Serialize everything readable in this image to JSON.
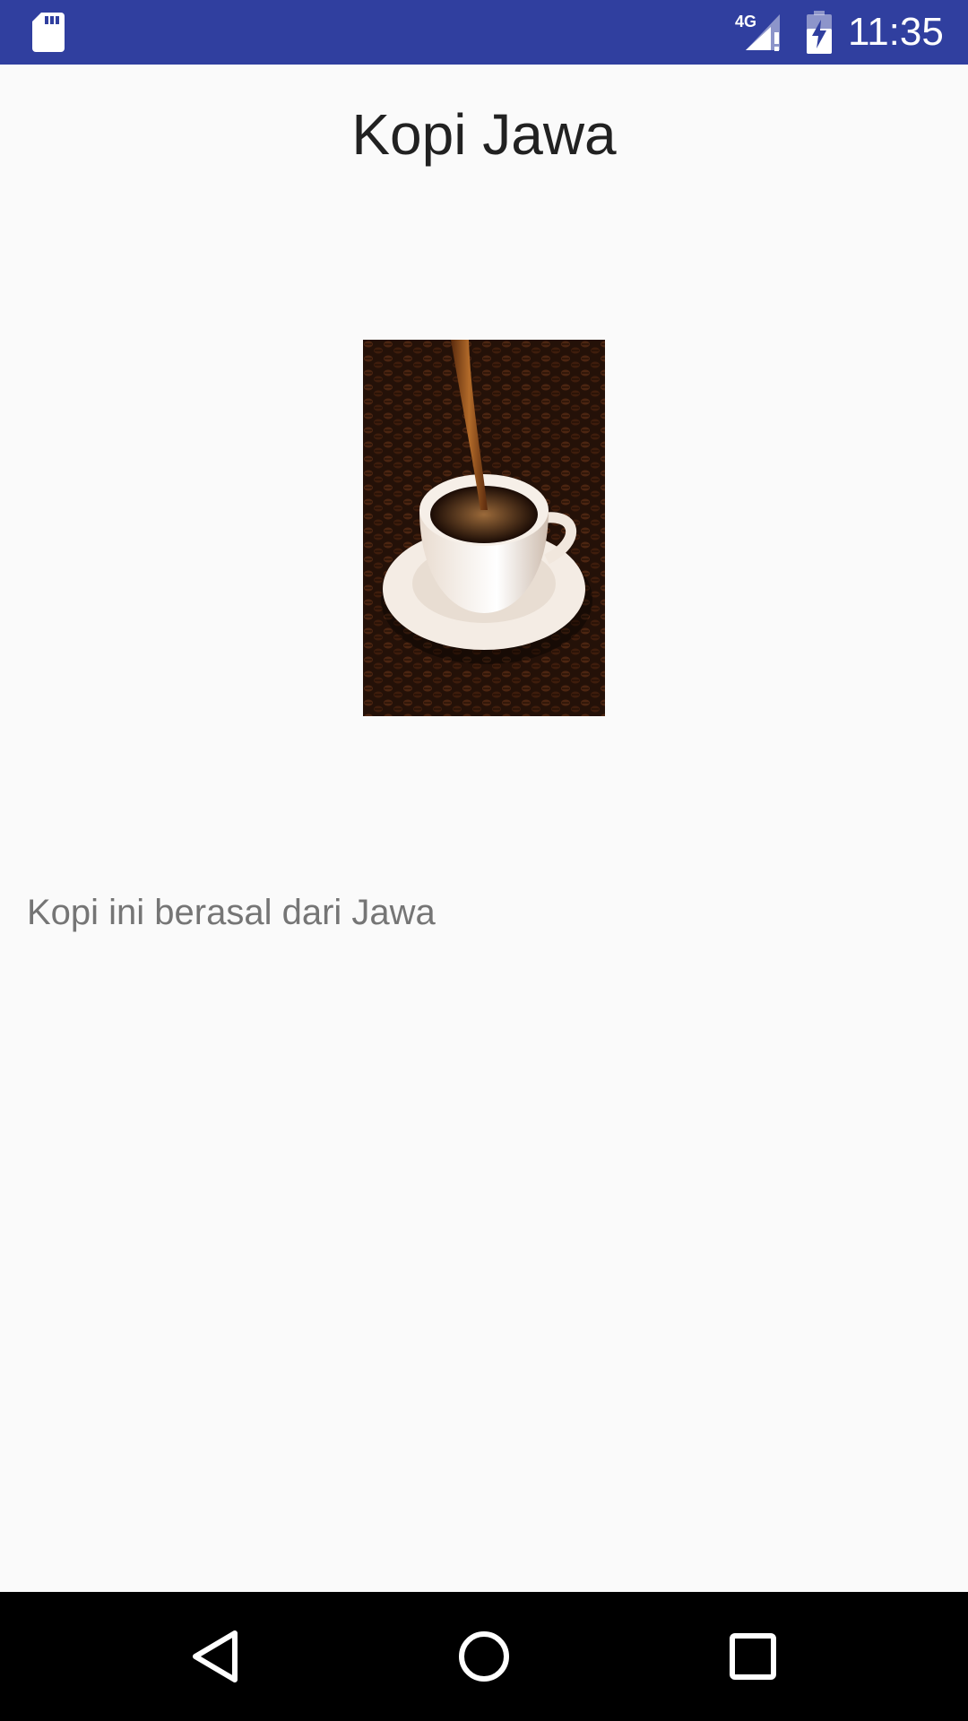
{
  "status_bar": {
    "time": "11:35",
    "network": "4G",
    "color": "#303f9f",
    "icons": [
      "sd-card-icon",
      "signal-4g-icon",
      "battery-charging-icon"
    ]
  },
  "page": {
    "title": "Kopi Jawa",
    "image_alt": "coffee-cup-pour-image",
    "description": "Kopi ini berasal dari Jawa"
  },
  "nav_bar": {
    "icons": [
      "back-icon",
      "home-icon",
      "recents-icon"
    ]
  }
}
